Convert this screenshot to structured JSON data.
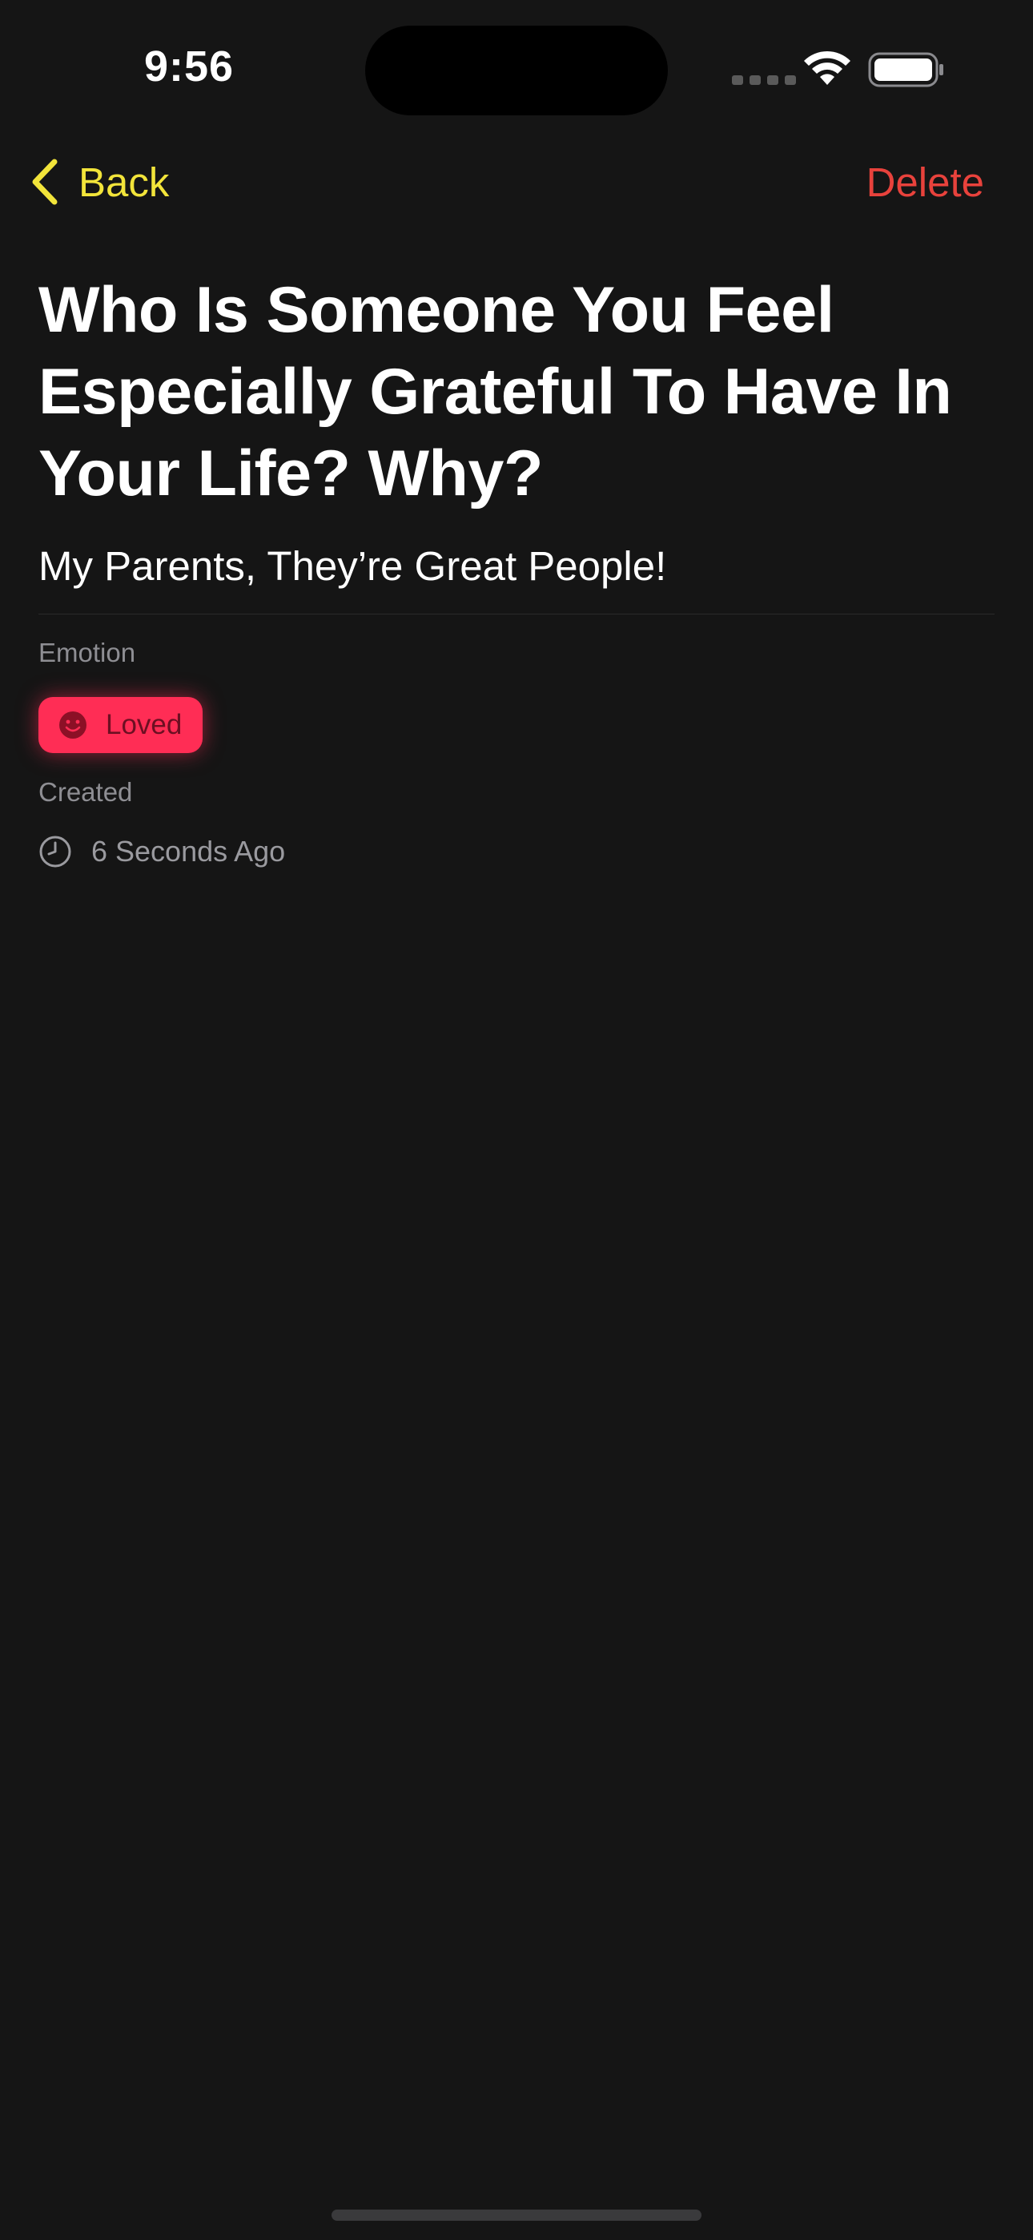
{
  "status_bar": {
    "time": "9:56"
  },
  "nav": {
    "back_label": "Back",
    "delete_label": "Delete"
  },
  "entry": {
    "title": "Who Is Someone You Feel Especially Grateful To Have In Your Life? Why?",
    "answer": "My Parents, They’re Great People!",
    "emotion_label": "Emotion",
    "emotion_value": "Loved",
    "created_label": "Created",
    "created_value": "6 Seconds Ago"
  },
  "icons": {
    "back": "chevron-left-icon",
    "emotion": "smiley-face-icon",
    "created": "clock-icon",
    "wifi": "wifi-icon",
    "battery": "battery-icon"
  },
  "colors": {
    "background": "#151515",
    "accent_yellow": "#f2e43a",
    "destructive_red": "#e8423c",
    "emotion_chip": "#ff2d55"
  }
}
